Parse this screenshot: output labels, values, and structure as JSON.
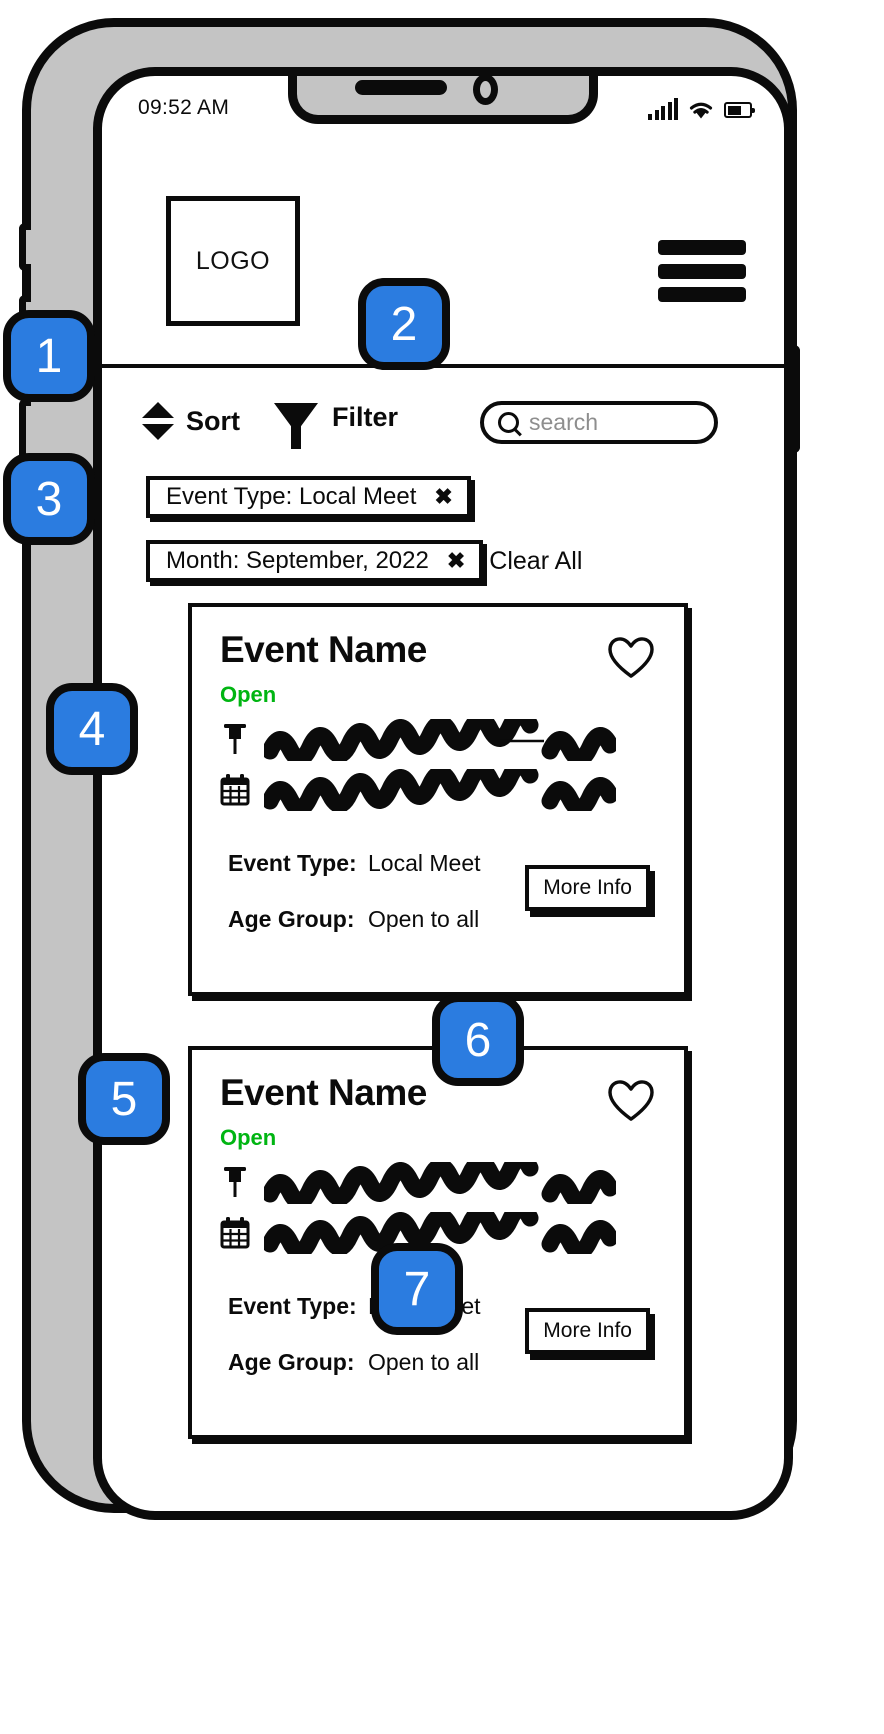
{
  "status_bar": {
    "time": "09:52 AM",
    "signal_icon": "signal-bars-icon",
    "wifi_icon": "wifi-icon",
    "battery_icon": "battery-icon"
  },
  "header": {
    "logo_text": "LOGO",
    "menu_icon": "hamburger-menu-icon"
  },
  "controls": {
    "sort_label": "Sort",
    "sort_icon": "sort-arrows-icon",
    "filter_label": "Filter",
    "filter_icon": "funnel-icon",
    "search_placeholder": "search",
    "search_value": "",
    "search_icon": "search-icon"
  },
  "filters": {
    "chips": [
      {
        "label": "Event Type: Local Meet",
        "close_icon": "close-x-icon"
      },
      {
        "label": "Month: September, 2022",
        "close_icon": "close-x-icon"
      }
    ],
    "clear_all_label": "Clear All"
  },
  "events": [
    {
      "name": "Event Name",
      "status": "Open",
      "status_color": "#00b512",
      "favorite_icon": "heart-outline-icon",
      "location_icon": "map-pin-icon",
      "location_placeholder": "scribble-placeholder",
      "date_icon": "calendar-icon",
      "date_placeholder": "scribble-placeholder",
      "details": [
        {
          "label": "Event Type:",
          "value": "Local Meet"
        },
        {
          "label": "Age Group:",
          "value": "Open to all"
        }
      ],
      "more_info_label": "More Info"
    },
    {
      "name": "Event Name",
      "status": "Open",
      "status_color": "#00b512",
      "favorite_icon": "heart-outline-icon",
      "location_icon": "map-pin-icon",
      "location_placeholder": "scribble-placeholder",
      "date_icon": "calendar-icon",
      "date_placeholder": "scribble-placeholder",
      "details": [
        {
          "label": "Event Type:",
          "value": "Local Meet"
        },
        {
          "label": "Age Group:",
          "value": "Open to all"
        }
      ],
      "more_info_label": "More Info"
    }
  ],
  "annotations": {
    "accent_color": "#2B7CE0",
    "badges": [
      {
        "number": "1"
      },
      {
        "number": "2"
      },
      {
        "number": "3"
      },
      {
        "number": "4"
      },
      {
        "number": "5"
      },
      {
        "number": "6"
      },
      {
        "number": "7"
      }
    ]
  }
}
